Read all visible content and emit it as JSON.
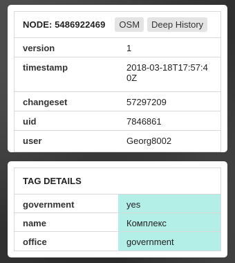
{
  "node_panel": {
    "title": "NODE: 5486922469",
    "osm_label": "OSM",
    "history_label": "Deep History",
    "rows": [
      {
        "key": "version",
        "value": "1"
      },
      {
        "key": "timestamp",
        "value": "2018-03-18T17:57:40Z"
      },
      {
        "key": "changeset",
        "value": "57297209"
      },
      {
        "key": "uid",
        "value": "7846861"
      },
      {
        "key": "user",
        "value": "Georg8002"
      }
    ]
  },
  "tag_panel": {
    "title": "TAG DETAILS",
    "rows": [
      {
        "key": "government",
        "value": "yes"
      },
      {
        "key": "name",
        "value": "Комплекс"
      },
      {
        "key": "office",
        "value": "government"
      }
    ],
    "highlight_color": "#b3efe7"
  }
}
